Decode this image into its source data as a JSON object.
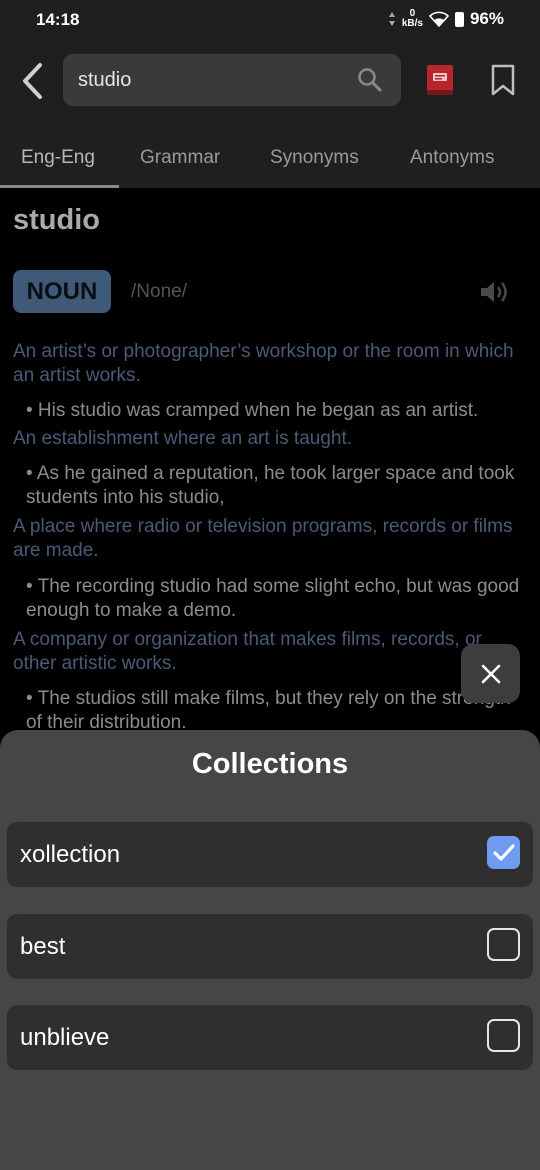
{
  "status_bar": {
    "time": "14:18",
    "net_speed_value": "0",
    "net_speed_unit": "kB/s",
    "battery": "96%"
  },
  "search": {
    "value": "studio",
    "placeholder": ""
  },
  "tabs": [
    {
      "label": "Eng-Eng",
      "active": true
    },
    {
      "label": "Grammar",
      "active": false
    },
    {
      "label": "Synonyms",
      "active": false
    },
    {
      "label": "Antonyms",
      "active": false
    }
  ],
  "entry": {
    "word": "studio",
    "part_of_speech": "NOUN",
    "phonetic": "/None/",
    "senses": [
      {
        "definition": "An artist’s or photographer’s workshop or the room in which an artist works.",
        "example": "• His studio was cramped when he began as an artist."
      },
      {
        "definition": "An establishment where an art is taught.",
        "example": "• As he gained a reputation, he took larger space and took students into his studio,"
      },
      {
        "definition": "A place where radio or television programs, records or films are made.",
        "example": "• The recording studio had some slight echo, but was good enough to make a demo."
      },
      {
        "definition": "A company or organization that makes films, records, or other artistic works.",
        "example": "• The studios still make films, but they rely on the strength of their distribution."
      }
    ]
  },
  "collections": {
    "title": "Collections",
    "items": [
      {
        "label": "xollection",
        "checked": true
      },
      {
        "label": "best",
        "checked": false
      },
      {
        "label": "unblieve",
        "checked": false
      }
    ]
  },
  "colors": {
    "accent": "#6e9cf0",
    "badge_bg": "#3f5a78",
    "definition": "#4a5a76",
    "sheet_bg": "#464646"
  },
  "icons": [
    "back-arrow-icon",
    "search-icon",
    "book-icon",
    "bookmark-icon",
    "speaker-icon",
    "close-icon",
    "checkbox-icon"
  ]
}
